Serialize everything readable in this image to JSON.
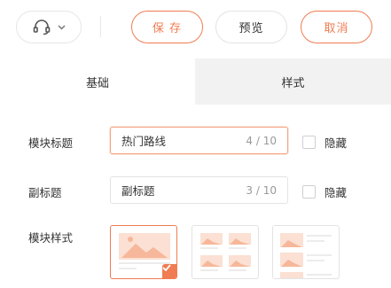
{
  "toolbar": {
    "support_icon": "headset-icon",
    "dropdown_icon": "chevron-down-icon",
    "save_label": "保 存",
    "preview_label": "预览",
    "cancel_label": "取消",
    "accent_color": "#f07c52"
  },
  "tabs": [
    {
      "label": "基础",
      "active": true
    },
    {
      "label": "样式",
      "active": false
    }
  ],
  "form": {
    "title": {
      "label": "模块标题",
      "value": "热门路线",
      "count": "4 / 10",
      "hide_label": "隐藏",
      "hide_checked": false
    },
    "subtitle": {
      "label": "副标题",
      "value": "副标题",
      "count": "3 / 10",
      "hide_label": "隐藏",
      "hide_checked": false
    },
    "style": {
      "label": "模块样式",
      "options": [
        {
          "name": "single-image",
          "selected": true
        },
        {
          "name": "grid-four",
          "selected": false
        },
        {
          "name": "list-three",
          "selected": false
        }
      ]
    }
  }
}
